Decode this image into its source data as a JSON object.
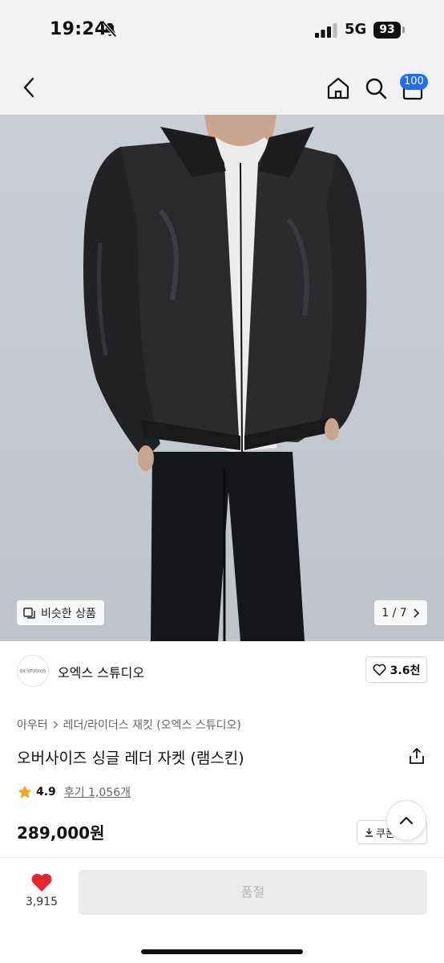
{
  "status_bar": {
    "time": "19:24",
    "network": "5G",
    "battery": "93",
    "icons": [
      "bell-muted-icon",
      "signal-icon"
    ]
  },
  "nav": {
    "icons": [
      "back-icon",
      "home-icon",
      "search-icon",
      "cart-icon"
    ],
    "cart_badge": "100"
  },
  "hero": {
    "similar_label": "비슷한 상품",
    "pager": "1 / 7"
  },
  "brand": {
    "logo_text": "OX STUDIOS",
    "name": "오엑스 스튜디오",
    "like_count": "3.6천"
  },
  "breadcrumb": [
    "아우터",
    "레더/라이더스 재킷 (오엑스 스튜디오)"
  ],
  "product": {
    "title": "오버사이즈 싱글 레더 자켓 (램스킨)",
    "rating": "4.9",
    "reviews": "후기 1,056개",
    "price": "289,000원",
    "coupon": "쿠폰"
  },
  "bottom": {
    "likes": "3,915",
    "buy_label": "품절"
  },
  "colors": {
    "accent": "#1f6bff",
    "heart": "#e8242e",
    "star": "#f5a623"
  }
}
